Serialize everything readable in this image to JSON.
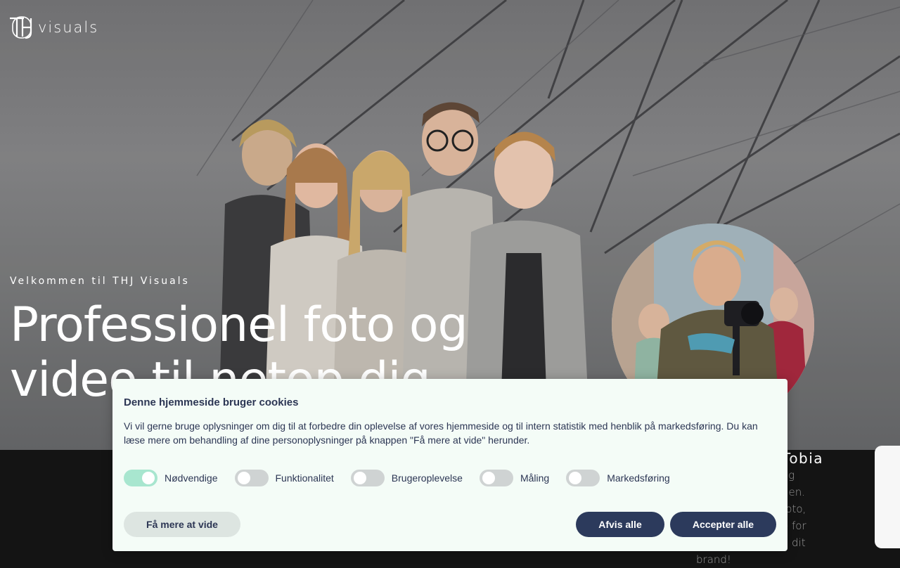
{
  "brand": {
    "logo_text": "visuals",
    "logo_mark": "TH"
  },
  "hero": {
    "tagline": "Velkommen til THJ Visuals",
    "headline_line1": "Professionel foto og",
    "headline_line2": "video til netop dig"
  },
  "about": {
    "name": "Tobias",
    "text_lines": [
      "og",
      "nen.",
      "foto,",
      "e for",
      "dit",
      "brand!"
    ]
  },
  "cookie_banner": {
    "title": "Denne hjemmeside bruger cookies",
    "body": "Vi vil gerne bruge oplysninger om dig til at forbedre din oplevelse af vores hjemmeside og til intern statistik med henblik på markedsføring. Du kan læse mere om behandling af dine personoplysninger på knappen \"Få mere at vide\" herunder.",
    "toggles": [
      {
        "label": "Nødvendige",
        "on": true
      },
      {
        "label": "Funktionalitet",
        "on": false
      },
      {
        "label": "Brugeroplevelse",
        "on": false
      },
      {
        "label": "Måling",
        "on": false
      },
      {
        "label": "Markedsføring",
        "on": false
      }
    ],
    "buttons": {
      "more": "Få mere at vide",
      "reject": "Afvis alle",
      "accept": "Accepter alle"
    }
  },
  "colors": {
    "banner_bg": "#f4fcf7",
    "primary_button": "#2c3a5c",
    "toggle_on": "#a8e6cf",
    "toggle_off": "#cfd3d3"
  }
}
